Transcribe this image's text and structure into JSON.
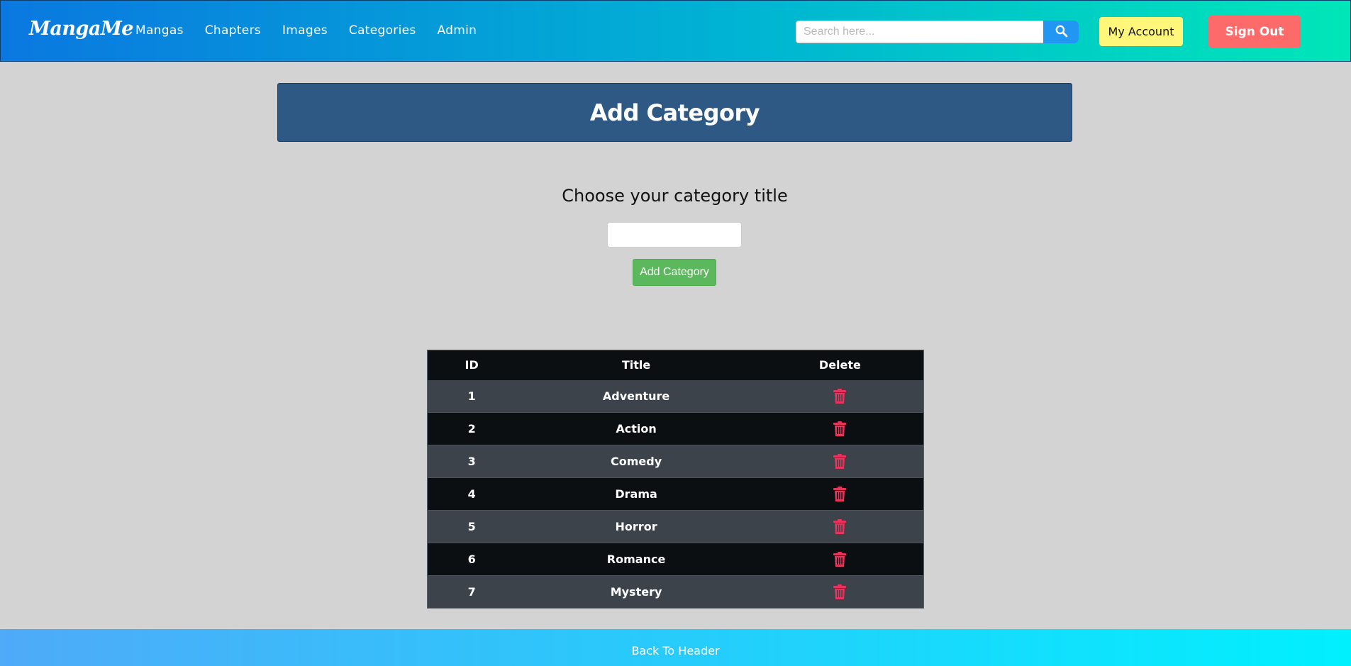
{
  "header": {
    "logo": "MangaMe",
    "nav": [
      "Mangas",
      "Chapters",
      "Images",
      "Categories",
      "Admin"
    ],
    "search_placeholder": "Search here...",
    "search_icon": "search-icon",
    "account_label": "My Account",
    "signout_label": "Sign Out"
  },
  "main": {
    "banner_title": "Add Category",
    "form_label": "Choose your category title",
    "title_value": "",
    "add_button": "Add Category"
  },
  "table": {
    "columns": [
      "ID",
      "Title",
      "Delete"
    ],
    "delete_icon": "trash-icon",
    "rows": [
      {
        "id": "1",
        "title": "Adventure"
      },
      {
        "id": "2",
        "title": "Action"
      },
      {
        "id": "3",
        "title": "Comedy"
      },
      {
        "id": "4",
        "title": "Drama"
      },
      {
        "id": "5",
        "title": "Horror"
      },
      {
        "id": "6",
        "title": "Romance"
      },
      {
        "id": "7",
        "title": "Mystery"
      }
    ]
  },
  "footer": {
    "back_label": "Back To Header"
  },
  "colors": {
    "banner": "#2e5984",
    "add_button": "#5cb85c",
    "account_button": "#fff67a",
    "signout_button": "#fd6a6a",
    "trash_icon": "#e8335c",
    "search_button": "#2196f3"
  }
}
